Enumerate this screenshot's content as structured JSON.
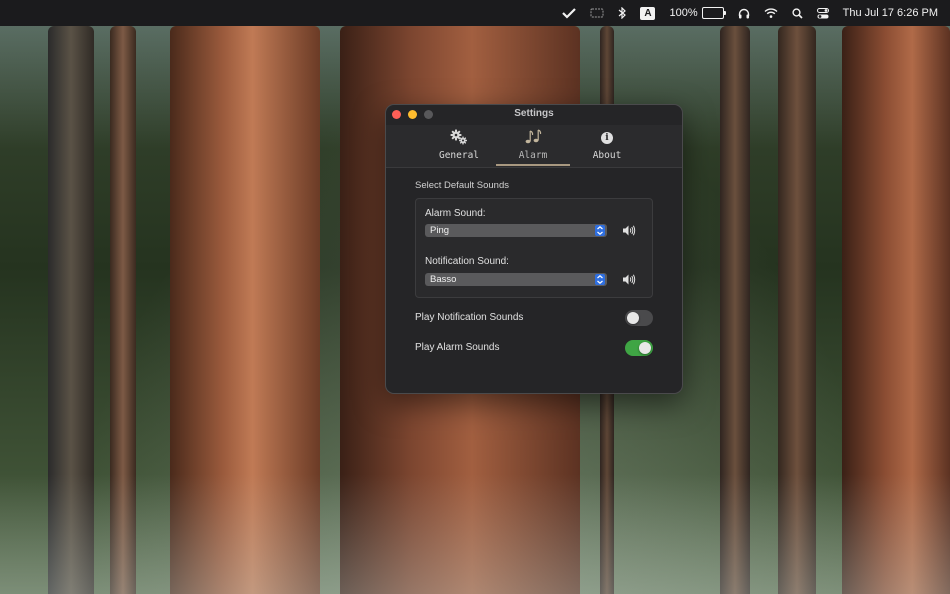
{
  "menubar": {
    "battery_percent": "100%",
    "clock": "Thu Jul 17  6:26 PM",
    "input_source": "A",
    "icons": [
      "checkmark-icon",
      "screen-mirroring-icon",
      "bluetooth-icon",
      "input-source-icon",
      "battery-icon",
      "headphones-icon",
      "wifi-icon",
      "spotlight-search-icon",
      "control-center-icon"
    ]
  },
  "window": {
    "title": "Settings",
    "tabs": [
      {
        "label": "General",
        "icon": "gears-icon",
        "selected": false
      },
      {
        "label": "Alarm",
        "icon": "music-notes-icon",
        "selected": true
      },
      {
        "label": "About",
        "icon": "info-icon",
        "selected": false
      }
    ],
    "section_title": "Select Default Sounds",
    "alarm_sound": {
      "label": "Alarm Sound:",
      "value": "Ping"
    },
    "notification_sound": {
      "label": "Notification Sound:",
      "value": "Basso"
    },
    "toggles": [
      {
        "label": "Play Notification Sounds",
        "on": false
      },
      {
        "label": "Play Alarm Sounds",
        "on": true
      }
    ],
    "colors": {
      "toggle_on": "#3fa544",
      "select_accent": "#2f6fe0",
      "close": "#fe5f57",
      "minimize": "#febc2e"
    }
  }
}
